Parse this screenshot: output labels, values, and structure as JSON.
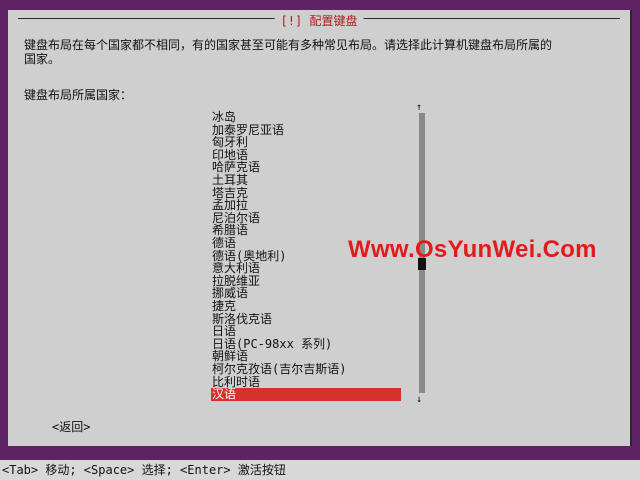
{
  "dialog": {
    "title": "[!] 配置键盘",
    "description": "键盘布局在每个国家都不相同，有的国家甚至可能有多种常见布局。请选择此计算机键盘布局所属的\n国家。",
    "prompt": "键盘布局所属国家：",
    "back_label": "<返回>"
  },
  "list": {
    "items": [
      "冰岛",
      "加泰罗尼亚语",
      "匈牙利",
      "印地语",
      "哈萨克语",
      "土耳其",
      "塔吉克",
      "孟加拉",
      "尼泊尔语",
      "希腊语",
      "德语",
      "德语(奥地利)",
      "意大利语",
      "拉脱维亚",
      "挪威语",
      "捷克",
      "斯洛伐克语",
      "日语",
      "日语(PC-98xx 系列)",
      "朝鲜语",
      "柯尔克孜语(吉尔吉斯语)",
      "比利时语",
      "汉语"
    ],
    "selected": "汉语",
    "scroll_up": "↑",
    "scroll_down": "↓"
  },
  "watermark": "Www.OsYunWei.Com",
  "statusbar": "<Tab> 移动; <Space> 选择; <Enter> 激活按钮",
  "colors": {
    "background": "#5f2363",
    "dialog": "#cfcfcf",
    "selection": "#d5322e",
    "title": "#b31b1b",
    "watermark": "#e11b1b"
  }
}
